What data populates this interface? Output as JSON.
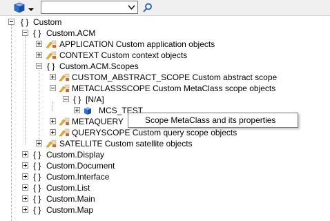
{
  "toolbar": {
    "search_value": "",
    "icons": [
      "cube-icon",
      "dropdown-arrow-icon",
      "search-icon"
    ]
  },
  "tree": {
    "nodes": [
      {
        "label": "Custom"
      },
      {
        "label": "Custom.ACM"
      },
      {
        "label": "APPLICATION Custom application objects"
      },
      {
        "label": "CONTEXT Custom context objects"
      },
      {
        "label": "Custom.ACM.Scopes"
      },
      {
        "label": "CUSTOM_ABSTRACT_SCOPE Custom abstract scope"
      },
      {
        "label": "METACLASSSCOPE Custom MetaClass scope objects"
      },
      {
        "label": "[N/A]"
      },
      {
        "label": "MCS_TEST"
      },
      {
        "label": "METAQUERY"
      },
      {
        "label": "QUERYSCOPE Custom query scope objects"
      },
      {
        "label": "SATELLITE Custom satellite objects"
      },
      {
        "label": "Custom.Display"
      },
      {
        "label": "Custom.Document"
      },
      {
        "label": "Custom.Interface"
      },
      {
        "label": "Custom.List"
      },
      {
        "label": "Custom.Main"
      },
      {
        "label": "Custom.Map"
      }
    ]
  },
  "tooltip": {
    "text": "Scope MetaClass and its properties"
  },
  "colors": {
    "accent": "#2f6fd0",
    "tooltip_border": "#767676",
    "tree_lines": "#a0a0a0"
  }
}
